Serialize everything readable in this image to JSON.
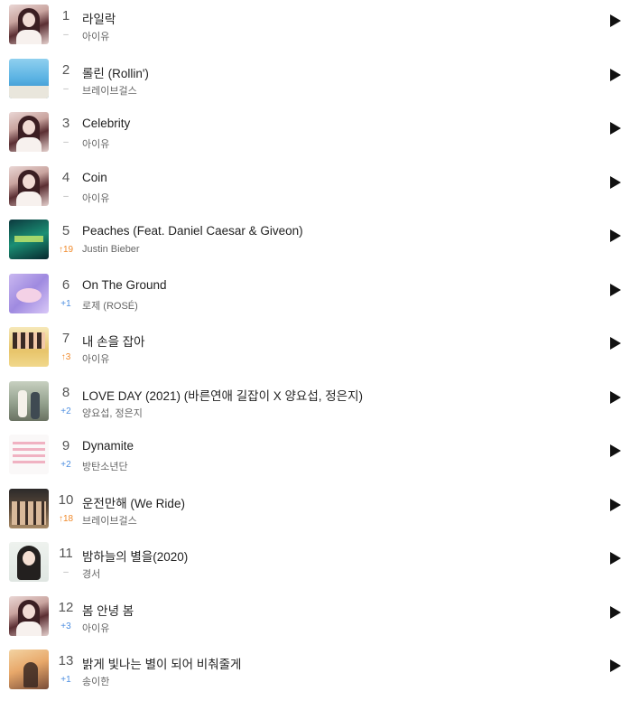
{
  "chart": {
    "rows": [
      {
        "rank": "1",
        "change": "–",
        "trend": "same",
        "title": "라일락",
        "artist": "아이유",
        "art": "iu"
      },
      {
        "rank": "2",
        "change": "–",
        "trend": "same",
        "title": "롤린 (Rollin')",
        "artist": "브레이브걸스",
        "art": "brave1"
      },
      {
        "rank": "3",
        "change": "–",
        "trend": "same",
        "title": "Celebrity",
        "artist": "아이유",
        "art": "iu"
      },
      {
        "rank": "4",
        "change": "–",
        "trend": "same",
        "title": "Coin",
        "artist": "아이유",
        "art": "iu"
      },
      {
        "rank": "5",
        "change": "↑19",
        "trend": "up",
        "title": "Peaches (Feat. Daniel Caesar & Giveon)",
        "artist": "Justin Bieber",
        "art": "justin"
      },
      {
        "rank": "6",
        "change": "+1",
        "trend": "down",
        "title": "On The Ground",
        "artist": "로제 (ROSÉ)",
        "art": "rose"
      },
      {
        "rank": "7",
        "change": "↑3",
        "trend": "up",
        "title": "내 손을 잡아",
        "artist": "아이유",
        "art": "hand"
      },
      {
        "rank": "8",
        "change": "+2",
        "trend": "down",
        "title": "LOVE DAY (2021) (바른연애 길잡이 X 양요섭, 정은지)",
        "artist": "양요섭, 정은지",
        "art": "love"
      },
      {
        "rank": "9",
        "change": "+2",
        "trend": "down",
        "title": "Dynamite",
        "artist": "방탄소년단",
        "art": "bts"
      },
      {
        "rank": "10",
        "change": "↑18",
        "trend": "up",
        "title": "운전만해 (We Ride)",
        "artist": "브레이브걸스",
        "art": "brave2"
      },
      {
        "rank": "11",
        "change": "–",
        "trend": "same",
        "title": "밤하늘의 별을(2020)",
        "artist": "경서",
        "art": "gs"
      },
      {
        "rank": "12",
        "change": "+3",
        "trend": "down",
        "title": "봄 안녕 봄",
        "artist": "아이유",
        "art": "iu"
      },
      {
        "rank": "13",
        "change": "+1",
        "trend": "down",
        "title": "밝게 빛나는 별이 되어 비춰줄게",
        "artist": "송이한",
        "art": "song"
      }
    ]
  },
  "icons": {
    "play": "play-icon"
  },
  "colors": {
    "up": "#f08a2c",
    "down": "#4d8ee0",
    "same": "#b0b0b0"
  }
}
